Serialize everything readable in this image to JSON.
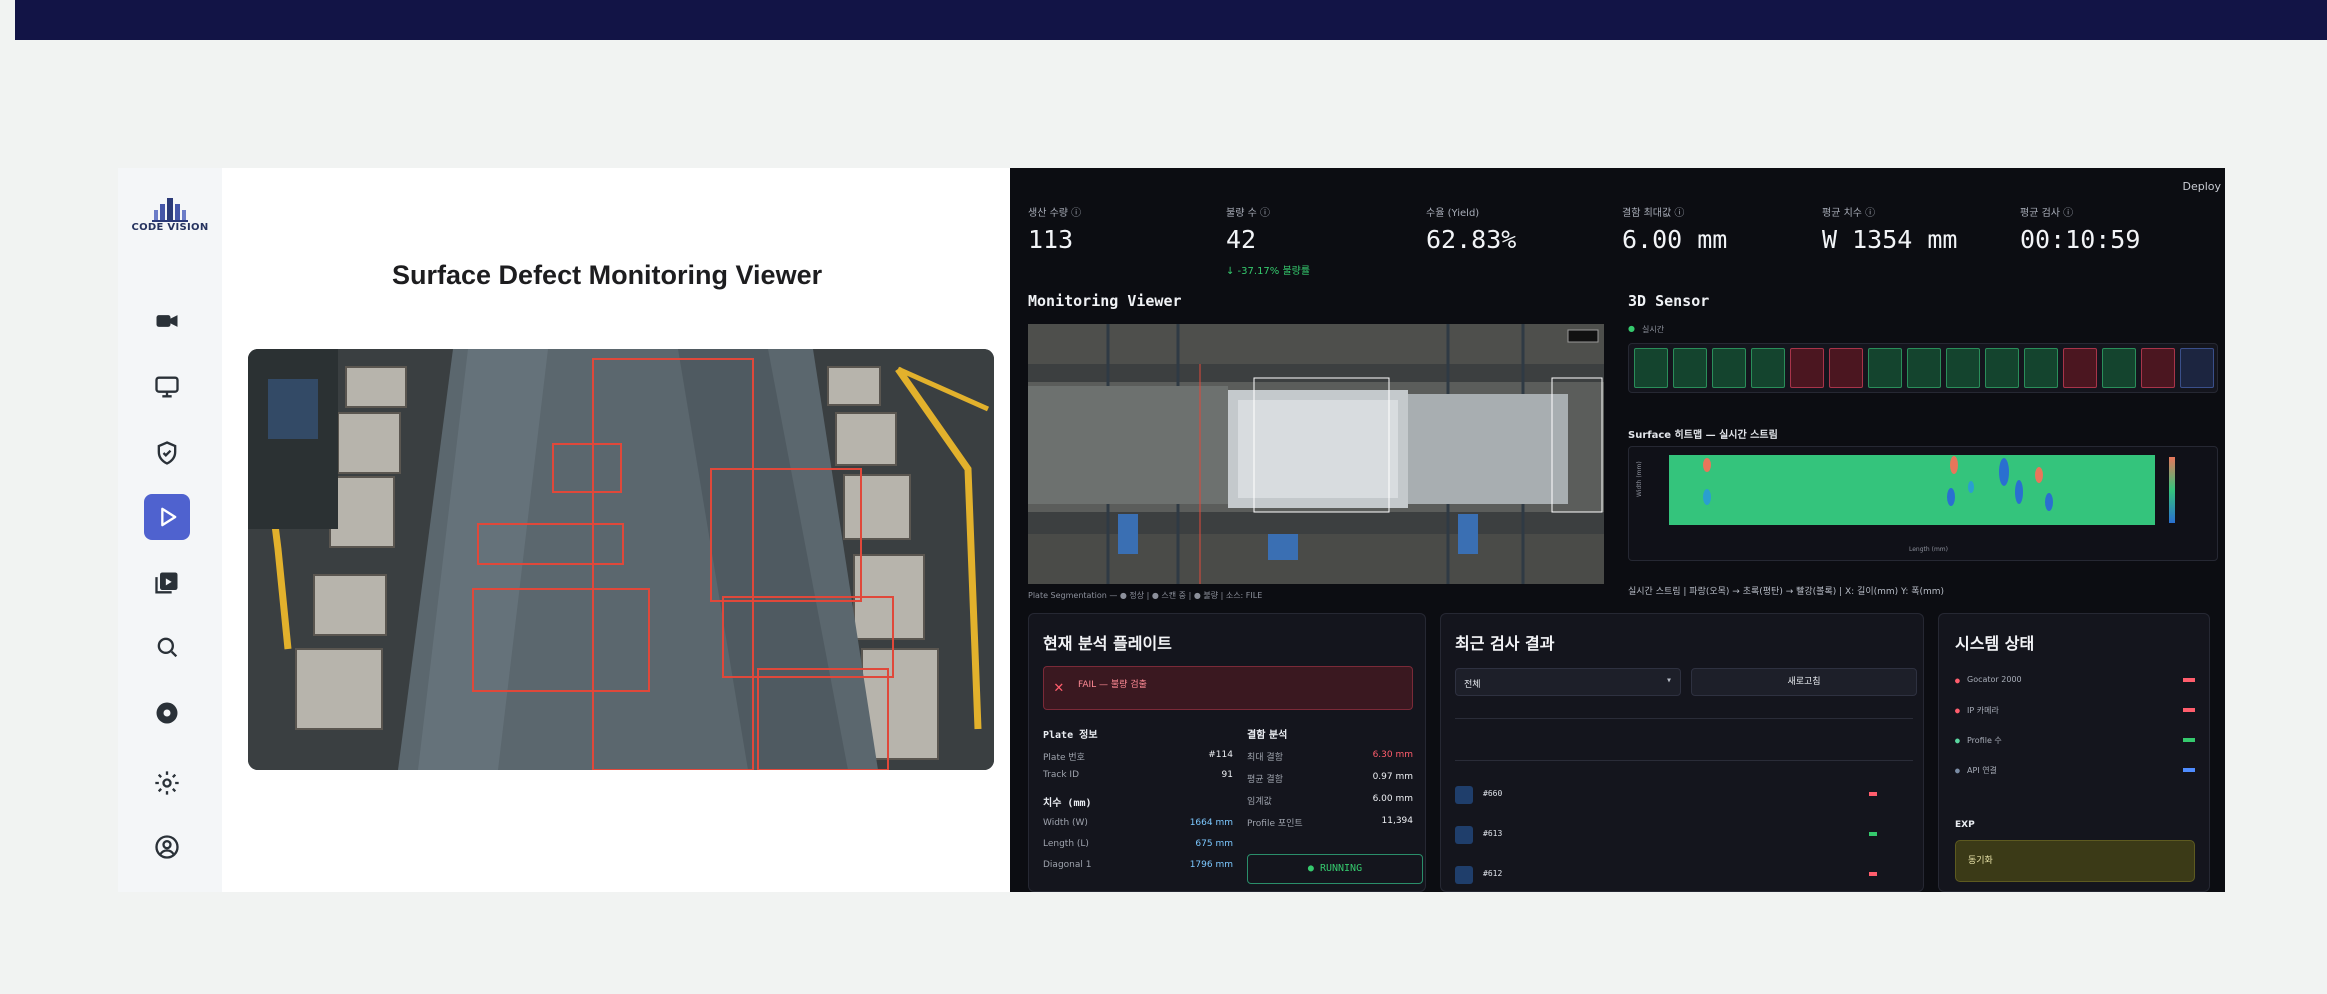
{
  "left": {
    "logo_text": "CODE VISION",
    "title": "Surface Defect Monitoring Viewer",
    "nav": [
      {
        "icon": "video-camera-icon"
      },
      {
        "icon": "monitor-icon"
      },
      {
        "icon": "shield-check-icon"
      },
      {
        "icon": "play-icon",
        "active": true
      },
      {
        "icon": "media-library-icon"
      },
      {
        "icon": "search-icon"
      },
      {
        "icon": "disc-icon"
      },
      {
        "icon": "gear-icon"
      },
      {
        "icon": "user-icon"
      }
    ]
  },
  "right": {
    "deploy": "Deploy",
    "metrics": [
      {
        "label": "생산 수량 ⓘ",
        "value": "113"
      },
      {
        "label": "불량 수 ⓘ",
        "value": "42",
        "delta": "↓ -37.17% 불량률"
      },
      {
        "label": "수율 (Yield)",
        "value": "62.83%"
      },
      {
        "label": "결함 최대값 ⓘ",
        "value": "6.00 mm"
      },
      {
        "label": "평균 치수 ⓘ",
        "value": "W 1354 mm"
      },
      {
        "label": "평균 검사 ⓘ",
        "value": "00:10:59"
      }
    ],
    "monitoring_title": "Monitoring Viewer",
    "segmentation_caption": "Plate Segmentation — ● 정상 | ● 스캔 중 | ● 불량 | 소스: FILE",
    "sensor_title": "3D Sensor",
    "sensor_status": "실시간",
    "heatmap_title": "Surface 히트맵 — 실시간 스트림",
    "heatmap_xlabel": "Length (mm)",
    "heatmap_ylabel": "Width (mm)",
    "heatmap_caption": "실시간 스트림 | 파랑(오목) → 초록(평탄) → 빨강(볼록) | X: 길이(mm) Y: 폭(mm)",
    "current": {
      "title": "현재 분석 플레이트",
      "alert": "FAIL — 불량 검출",
      "plate_info_title": "Plate 정보",
      "plate_rows": [
        {
          "label": "Plate 번호",
          "value": "#114"
        },
        {
          "label": "Track ID",
          "value": "91"
        }
      ],
      "dims_title": "치수 (mm)",
      "dims_rows": [
        {
          "label": "Width (W)",
          "value": "1664 mm"
        },
        {
          "label": "Length (L)",
          "value": "675 mm"
        },
        {
          "label": "Diagonal 1",
          "value": "1796 mm"
        }
      ],
      "defect_title": "결함 분석",
      "defect_rows": [
        {
          "label": "최대 결함",
          "value": "6.30 mm",
          "color": "#ff5d6c"
        },
        {
          "label": "평균 결함",
          "value": "0.97 mm",
          "color": "#eef0f4"
        },
        {
          "label": "임계값",
          "value": "6.00 mm",
          "color": "#eef0f4"
        },
        {
          "label": "Profile 포인트",
          "value": "11,394",
          "color": "#eef0f4"
        }
      ],
      "status_button": "● RUNNING"
    },
    "recent": {
      "title": "최근 검사 결과",
      "filter": "전체",
      "refresh": "새로고침",
      "rows": [
        {
          "id": "#660",
          "status_color": "#ff5d6c"
        },
        {
          "id": "#613",
          "status_color": "#35c96d"
        },
        {
          "id": "#612",
          "status_color": "#ff5d6c"
        }
      ]
    },
    "system": {
      "title": "시스템 상태",
      "rows": [
        {
          "label": "Gocator 2000",
          "dot": "#ff5d6c",
          "status_color": "#ff5d6c"
        },
        {
          "label": "IP 카메라",
          "dot": "#ff5d6c",
          "status_color": "#ff5d6c"
        },
        {
          "label": "Profile 수",
          "dot": "#5ad6a0",
          "status_color": "#35c96d"
        },
        {
          "label": "API 연결",
          "dot": "#7a8ca5",
          "status_color": "#4f8cff"
        }
      ],
      "exp_label": "EXP",
      "exp_button": "동기화"
    }
  },
  "sensor_cells": [
    "ok",
    "ok",
    "ok",
    "ok",
    "bad",
    "bad",
    "ok",
    "ok",
    "ok",
    "ok",
    "ok",
    "bad",
    "ok",
    "bad",
    "blank"
  ],
  "colors": {
    "topbar": "#121446",
    "accent": "#4f62cf",
    "panel": "#0c0d12",
    "ok": "#35c96d",
    "bad": "#ff5d6c",
    "box": "#e0483a"
  }
}
